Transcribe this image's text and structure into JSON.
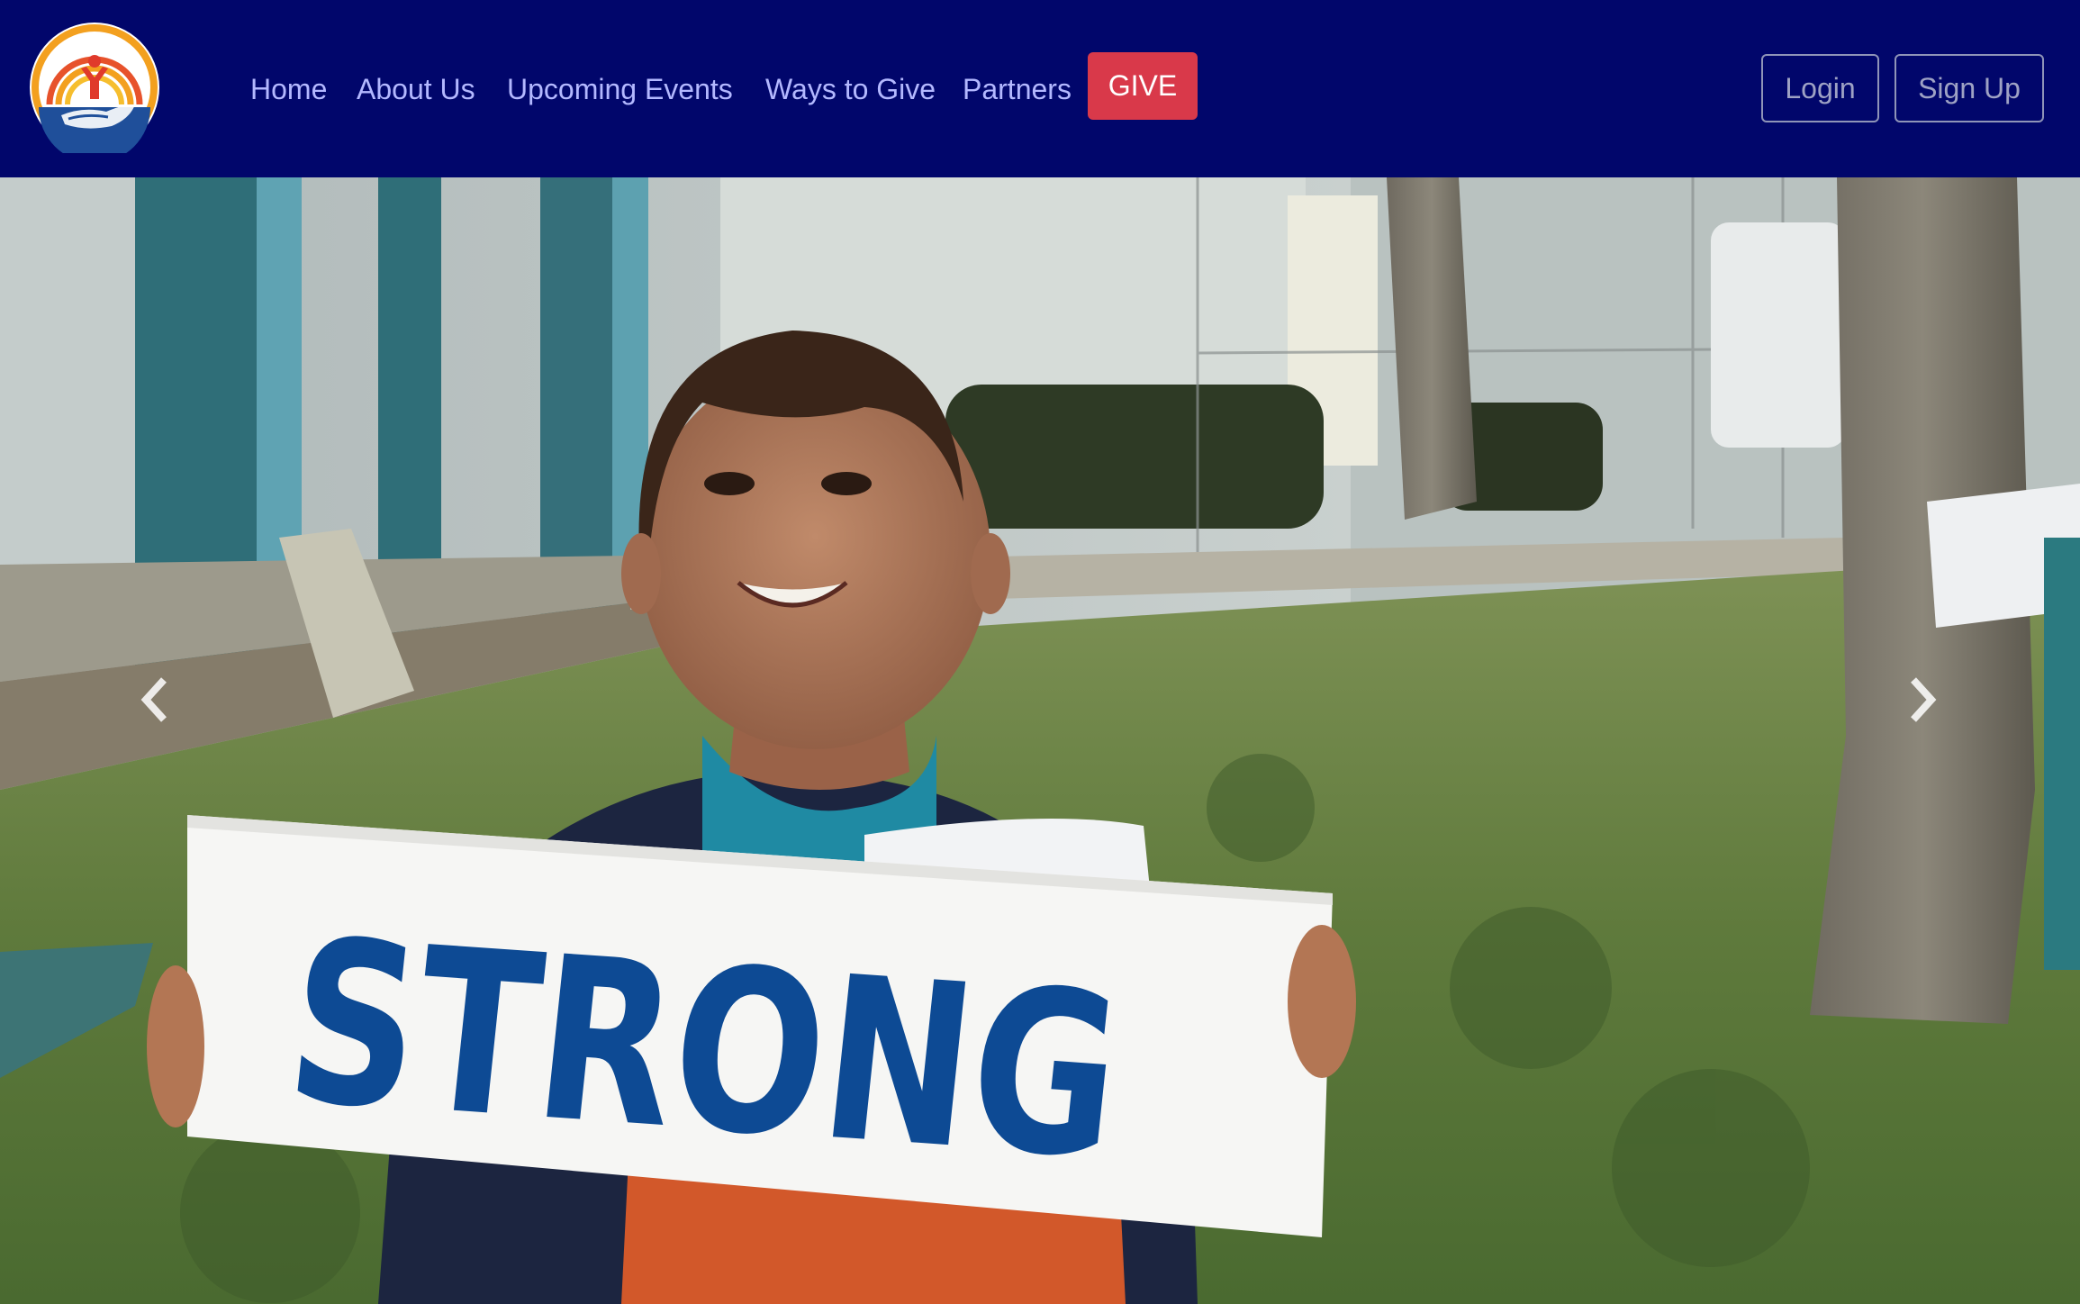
{
  "nav": {
    "logo_icon": "united-way-hand-logo-icon",
    "links": [
      {
        "label": "Home"
      },
      {
        "label": "About Us"
      },
      {
        "label": "Upcoming Events"
      },
      {
        "label": "Ways to Give"
      },
      {
        "label": "Partners"
      }
    ],
    "give_label": "GIVE",
    "login_label": "Login",
    "signup_label": "Sign Up"
  },
  "hero": {
    "sign_text": "STRONG",
    "prev_icon": "chevron-left-icon",
    "next_icon": "chevron-right-icon"
  },
  "colors": {
    "navbar_bg": "#01066b",
    "nav_link": "#b3b8ff",
    "give_bg": "#d9394a",
    "sign_text": "#0d4a94"
  }
}
